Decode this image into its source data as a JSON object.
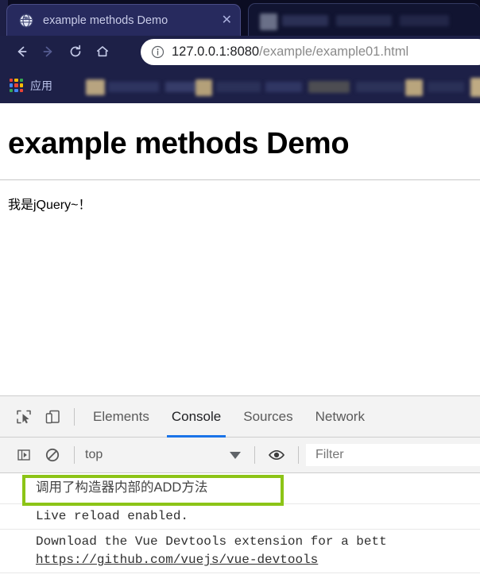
{
  "browser": {
    "tab": {
      "title": "example methods Demo",
      "favicon_icon": "globe-icon",
      "close_icon": "close-icon"
    },
    "inactive_tab": {
      "title": ""
    },
    "nav": {
      "back_icon": "back-arrow-icon",
      "forward_icon": "forward-arrow-icon",
      "reload_icon": "reload-icon",
      "home_icon": "home-icon"
    },
    "omnibox": {
      "info_icon": "info-circle-icon",
      "host": "127.0.0.1:8080",
      "path": "/example/example01.html",
      "full_url": "127.0.0.1:8080/example/example01.html"
    },
    "bookmarks": {
      "apps_icon": "apps-grid-icon",
      "apps_label": "应用"
    }
  },
  "page": {
    "heading": "example methods Demo",
    "paragraph": "我是jQuery~！"
  },
  "devtools": {
    "inspect_icon": "inspect-element-icon",
    "device_icon": "device-toolbar-icon",
    "tabs": [
      {
        "label": "Elements",
        "active": false
      },
      {
        "label": "Console",
        "active": true
      },
      {
        "label": "Sources",
        "active": false
      },
      {
        "label": "Network",
        "active": false
      }
    ],
    "console_toolbar": {
      "sidebar_icon": "console-sidebar-icon",
      "clear_icon": "clear-console-icon",
      "context_value": "top",
      "caret_icon": "chevron-down-icon",
      "eye_icon": "live-expression-eye-icon",
      "filter_placeholder": "Filter"
    },
    "messages": [
      {
        "text": "调用了构造器内部的ADD方法",
        "cjk": true,
        "highlighted": true
      },
      {
        "text": "Live reload enabled.",
        "cjk": false,
        "highlighted": false
      },
      {
        "text": "Download the Vue Devtools extension for a bett",
        "link": "https://github.com/vuejs/vue-devtools",
        "cjk": false,
        "highlighted": false
      }
    ]
  },
  "colors": {
    "chrome_dark": "#1d2047",
    "tabstrip": "#0b0c22",
    "active_tab": "#272a5e",
    "devtools_accent": "#1a73e8",
    "annotation_green": "#8cc417"
  }
}
